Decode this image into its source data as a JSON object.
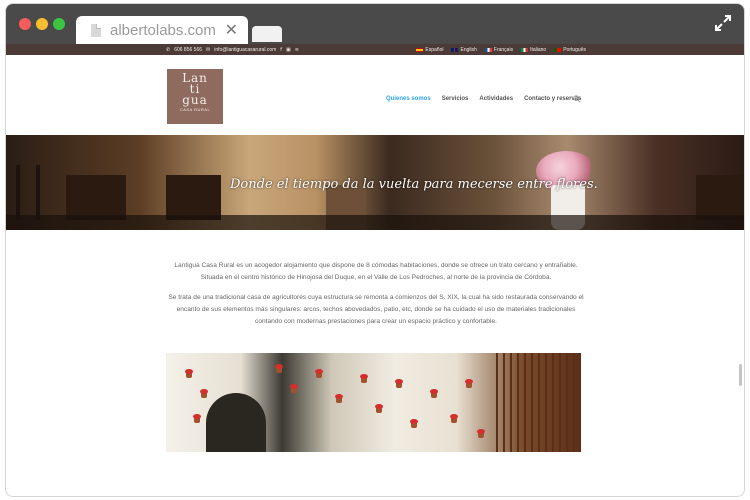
{
  "browser": {
    "tab_title": "albertolabs.com",
    "close_glyph": "✕"
  },
  "topbar": {
    "phone": "606 856 566",
    "email": "info@lantiguacasarural.com",
    "languages": [
      {
        "label": "Español",
        "flag": "spain-flag"
      },
      {
        "label": "English",
        "flag": "uk-flag"
      },
      {
        "label": "Français",
        "flag": "france-flag"
      },
      {
        "label": "Italiano",
        "flag": "italy-flag"
      },
      {
        "label": "Português",
        "flag": "portugal-flag"
      }
    ],
    "colors": {
      "background": "#4b3a36"
    }
  },
  "logo": {
    "line1": "Lan",
    "line2": "ti",
    "line3": "gua",
    "subtitle": "CASA RURAL",
    "color": "#8e6a5f"
  },
  "nav": {
    "items": [
      {
        "label": "Quienes somos",
        "active": true
      },
      {
        "label": "Servicios",
        "active": false
      },
      {
        "label": "Actividades",
        "active": false
      },
      {
        "label": "Contacto y reservas",
        "active": false
      }
    ],
    "accent": "#2ea3f2"
  },
  "hero": {
    "caption": "Donde el tiempo da la vuelta para mecerse entre flores."
  },
  "content": {
    "paragraph1": "Lantigua Casa Rural es un acogedor alojamiento que dispone de 8 cómodas habitaciones, donde se ofrece un trato cercano y entrañable. Situada en el centro histórico de Hinojosa del Duque, en el Valle de Los Pedroches, al norte de la provincia de Córdoba.",
    "paragraph2": "Se trata de una tradicional casa de agricultores cuya estructura se remonta a comienzos del S. XIX, la cual ha sido restaurada conservando el encanto de sus elementos más singulares: arcos, techos abovedados, patio, etc, donde se ha cuidado el uso de materiales tradicionales contando con modernas prestaciones para crear un espacio práctico y confortable."
  }
}
